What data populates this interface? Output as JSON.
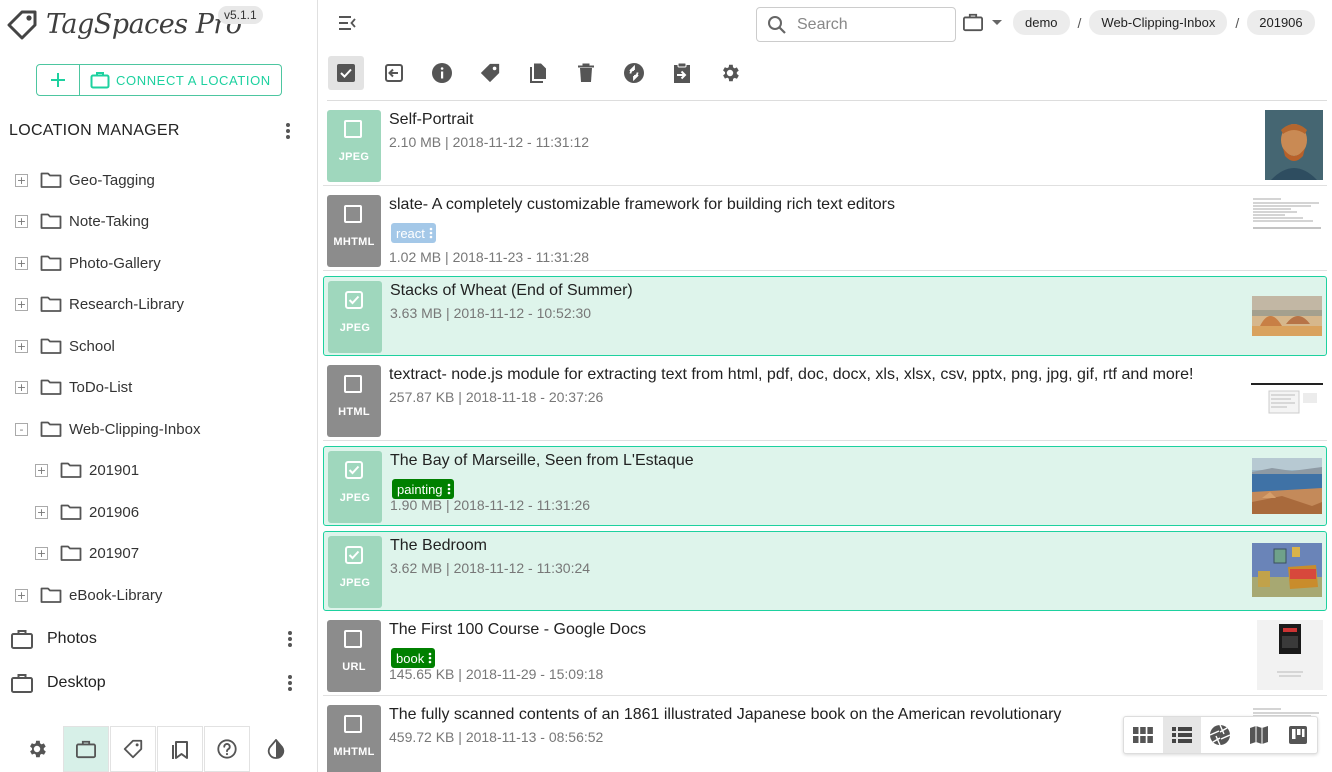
{
  "app": {
    "name": "TagSpaces Pro",
    "version": "v5.1.1"
  },
  "sidebar": {
    "connect_label": "CONNECT A LOCATION",
    "location_manager_title": "LOCATION MANAGER",
    "tree": [
      {
        "label": "Geo-Tagging",
        "expander": "+"
      },
      {
        "label": "Note-Taking",
        "expander": "+"
      },
      {
        "label": "Photo-Gallery",
        "expander": "+"
      },
      {
        "label": "Research-Library",
        "expander": "+"
      },
      {
        "label": "School",
        "expander": "+"
      },
      {
        "label": "ToDo-List",
        "expander": "+"
      },
      {
        "label": "Web-Clipping-Inbox",
        "expander": "-"
      },
      {
        "label": "201901",
        "expander": "+"
      },
      {
        "label": "201906",
        "expander": "+"
      },
      {
        "label": "201907",
        "expander": "+"
      },
      {
        "label": "eBook-Library",
        "expander": "+"
      }
    ],
    "locations": [
      {
        "label": "Photos"
      },
      {
        "label": "Desktop"
      }
    ]
  },
  "header": {
    "search_placeholder": "Search",
    "breadcrumbs": [
      "demo",
      "Web-Clipping-Inbox",
      "201906"
    ],
    "separator": "/"
  },
  "files": [
    {
      "title": "Self-Portrait",
      "ext": "JPEG",
      "size": "2.10 MB",
      "date": "2018-11-12 - 11:31:12",
      "selected": false,
      "tag": null
    },
    {
      "title": "slate- A completely customizable framework for building rich text editors",
      "ext": "MHTML",
      "size": "1.02 MB",
      "date": "2018-11-23 - 11:31:28",
      "selected": false,
      "tag": "react"
    },
    {
      "title": "Stacks of Wheat (End of Summer)",
      "ext": "JPEG",
      "size": "3.63 MB",
      "date": "2018-11-12 - 10:52:30",
      "selected": true,
      "tag": null
    },
    {
      "title": "textract- node.js module for extracting text from html, pdf, doc, docx, xls, xlsx, csv, pptx, png, jpg, gif, rtf and more!",
      "ext": "HTML",
      "size": "257.87 KB",
      "date": "2018-11-18 - 20:37:26",
      "selected": false,
      "tag": null
    },
    {
      "title": "The Bay of Marseille, Seen from L'Estaque",
      "ext": "JPEG",
      "size": "1.90 MB",
      "date": "2018-11-12 - 11:31:26",
      "selected": true,
      "tag": "painting"
    },
    {
      "title": "The Bedroom",
      "ext": "JPEG",
      "size": "3.62 MB",
      "date": "2018-11-12 - 11:30:24",
      "selected": true,
      "tag": null
    },
    {
      "title": "The First 100 Course - Google Docs",
      "ext": "URL",
      "size": "145.65 KB",
      "date": "2018-11-29 - 15:09:18",
      "selected": false,
      "tag": "book"
    },
    {
      "title": "The fully scanned contents of an 1861 illustrated Japanese book on the American revolutionary",
      "ext": "MHTML",
      "size": "459.72 KB",
      "date": "2018-11-13 - 08:56:52",
      "selected": false,
      "tag": null
    }
  ],
  "meta_separator": " | ",
  "colors": {
    "accent": "#1dd19f",
    "selected_bg": "#def4eb",
    "tag_green": "#008000",
    "tag_blue": "#a4c8e8",
    "ext_gray": "#8c8c8c",
    "ext_image": "#9fd7bd"
  }
}
